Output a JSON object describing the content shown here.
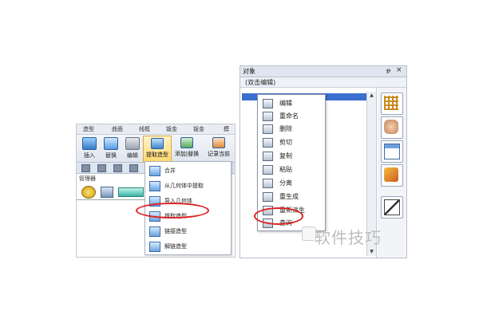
{
  "left_window": {
    "menubar": [
      "造型",
      "曲面",
      "线框",
      "钣金",
      "钣金",
      "模"
    ],
    "ribbon": {
      "buttons": [
        "插入",
        "替换",
        "编辑",
        "提取造型",
        "添加|替换",
        "记录当前"
      ]
    },
    "manager_label": "管理器",
    "dropdown_items": [
      "合并",
      "从几何体中提取",
      "导入几何体",
      "提取造型",
      "链接造型",
      "解链造型"
    ]
  },
  "right_window": {
    "title": "对象",
    "pin": "ᵽ",
    "close": "×",
    "subtitle": "(双击编辑)",
    "context_menu": [
      "编辑",
      "重命名",
      "删除",
      "剪切",
      "复制",
      "粘贴",
      "分离",
      "重生成",
      "重新派生",
      "查询"
    ],
    "scroll_up": "▲",
    "scroll_down": "▼"
  },
  "watermark": "软件技巧",
  "colors": {
    "highlight_red": "#dd2222",
    "selection_blue": "#3a6fcf"
  }
}
